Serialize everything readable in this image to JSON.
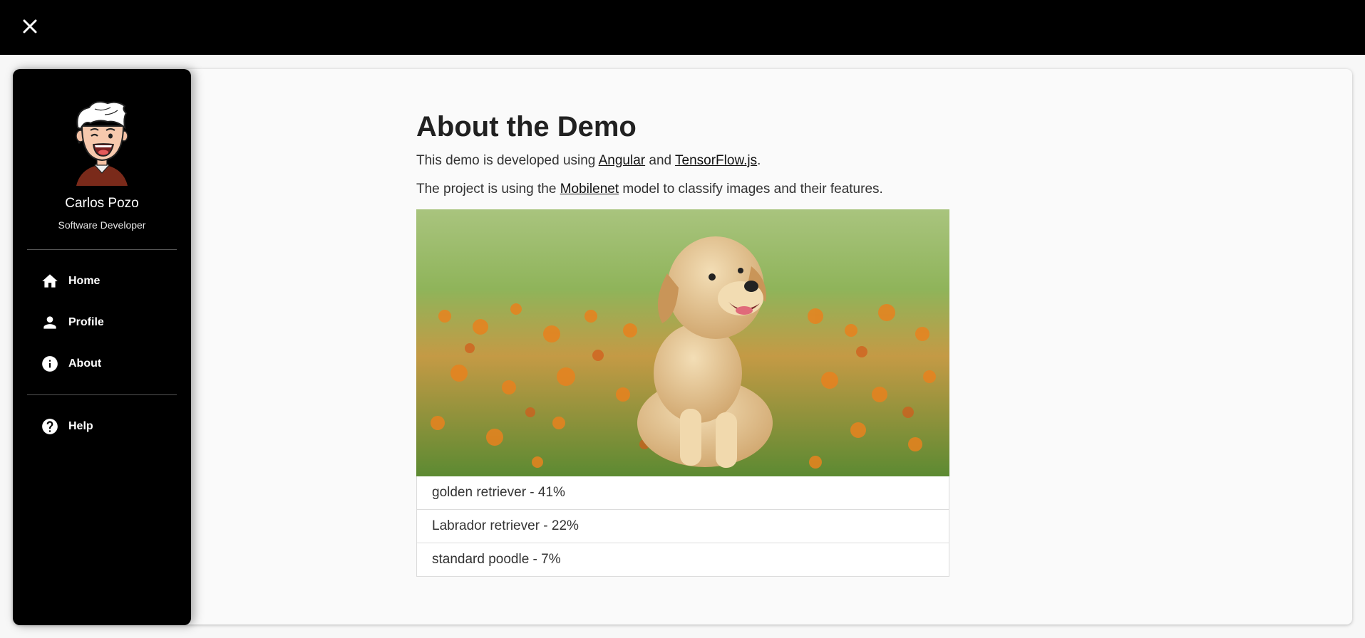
{
  "topbar": {
    "close_icon": "close-icon"
  },
  "sidebar": {
    "user_name": "Carlos Pozo",
    "user_role": "Software Developer",
    "nav": [
      {
        "label": "Home",
        "icon": "home-icon"
      },
      {
        "label": "Profile",
        "icon": "person-icon"
      },
      {
        "label": "About",
        "icon": "info-icon"
      }
    ],
    "secondary_nav": [
      {
        "label": "Help",
        "icon": "help-icon"
      }
    ]
  },
  "main": {
    "title": "About the Demo",
    "para1": {
      "prefix": "This demo is developed using ",
      "link1": "Angular",
      "middle": " and ",
      "link2": "TensorFlow.js",
      "suffix": "."
    },
    "para2": {
      "prefix": "The project is using the ",
      "link": "Mobilenet",
      "suffix": " model to classify images and their features."
    },
    "predictions": [
      "golden retriever - 41%",
      "Labrador retriever - 22%",
      "standard poodle - 7%"
    ]
  }
}
